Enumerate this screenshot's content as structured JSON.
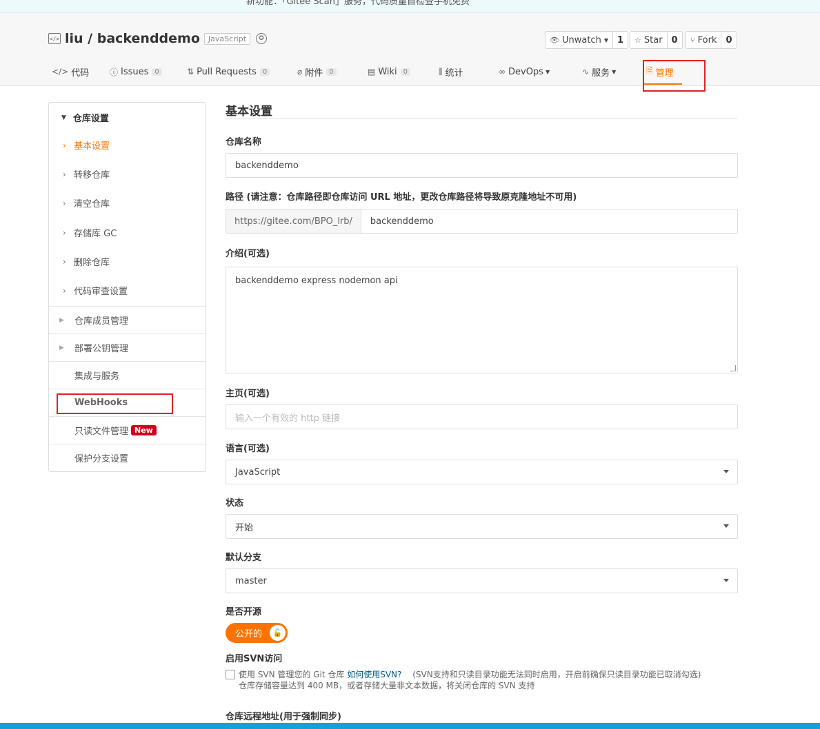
{
  "notice": {
    "text": "新功能：「Gitee Scan」服务，代码质量自检查手机免费"
  },
  "repo": {
    "owner_repo": "liu / backenddemo",
    "language": "JavaScript"
  },
  "actions": {
    "unwatch_label": "Unwatch",
    "unwatch_count": "1",
    "star_label": "Star",
    "star_count": "0",
    "fork_label": "Fork",
    "fork_count": "0"
  },
  "tabs": [
    {
      "label": "代码",
      "icon": "code-icon"
    },
    {
      "label": "Issues",
      "count": "0",
      "icon": "issue-icon"
    },
    {
      "label": "Pull Requests",
      "count": "0",
      "icon": "pull-request-icon"
    },
    {
      "label": "附件",
      "count": "0",
      "icon": "attachment-icon"
    },
    {
      "label": "Wiki",
      "count": "0",
      "icon": "book-icon"
    },
    {
      "label": "统计",
      "icon": "chart-icon"
    },
    {
      "label": "DevOps",
      "icon": "infinity-icon"
    },
    {
      "label": "服务",
      "icon": "pulse-icon"
    },
    {
      "label": "管理",
      "icon": "settings-doc-icon"
    }
  ],
  "sidebar": {
    "head": "仓库设置",
    "sub_items": [
      "基本设置",
      "转移仓库",
      "清空仓库",
      "存储库 GC",
      "删除仓库",
      "代码审查设置"
    ],
    "rows": [
      "仓库成员管理",
      "部署公钥管理",
      "集成与服务",
      "WebHooks",
      "只读文件管理",
      "保护分支设置"
    ],
    "new_badge": "New"
  },
  "form": {
    "title": "基本设置",
    "name_label": "仓库名称",
    "name_value": "backenddemo",
    "path_label": "路径 (请注意：仓库路径即仓库访问 URL 地址，更改仓库路径将导致原克隆地址不可用)",
    "path_prefix": "https://gitee.com/BPO_lrb/",
    "path_value": "backenddemo",
    "desc_label": "介绍(可选)",
    "desc_value": "backenddemo express nodemon api",
    "homepage_label": "主页(可选)",
    "homepage_placeholder": "输入一个有效的 http 链接",
    "lang_label": "语言(可选)",
    "lang_value": "JavaScript",
    "status_label": "状态",
    "status_value": "开始",
    "branch_label": "默认分支",
    "branch_value": "master",
    "open_label": "是否开源",
    "open_value": "公开的",
    "svn_label": "启用SVN访问",
    "svn_text_1": "使用 SVN 管理您的 Git 仓库",
    "svn_link": "如何使用SVN?",
    "svn_text_2": "(SVN支持和只读目录功能无法同时启用，开启前确保只读目录功能已取消勾选)",
    "svn_text_3": "仓库存储容量达到 400 MB，或者存储大量非文本数据，将关闭仓库的 SVN 支持",
    "remote_label": "仓库远程地址(用于强制同步)"
  },
  "colors": {
    "accent": "#fe7300",
    "highlight": "#e02020",
    "new_badge": "#d0021b"
  }
}
